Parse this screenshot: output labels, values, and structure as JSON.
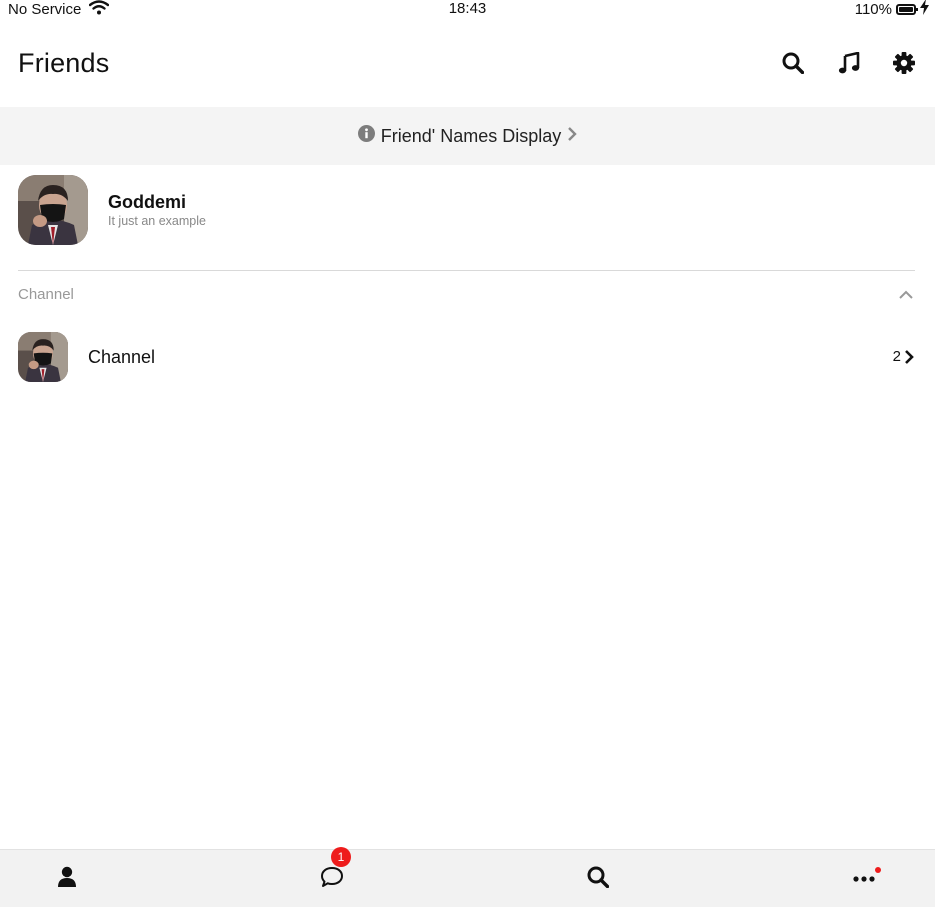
{
  "status_bar": {
    "carrier": "No Service",
    "time": "18:43",
    "battery": "110%"
  },
  "header": {
    "title": "Friends",
    "icons": [
      "search-icon",
      "music-note-icon",
      "gear-icon"
    ]
  },
  "banner": {
    "text": "Friend' Names Display",
    "icon": "info-icon"
  },
  "profile": {
    "name": "Goddemi",
    "status": "It just an example"
  },
  "section": {
    "title": "Channel",
    "expanded": true
  },
  "channel": {
    "name": "Channel",
    "count": "2"
  },
  "tab_bar": {
    "tabs": [
      "friends-tab",
      "chats-tab",
      "search-tab",
      "more-tab"
    ],
    "chat_badge": "1",
    "more_has_dot": true
  },
  "colors": {
    "badge": "#ee1c1c",
    "banner_bg": "#f4f4f4",
    "tab_bar_bg": "#f2f2f2"
  }
}
